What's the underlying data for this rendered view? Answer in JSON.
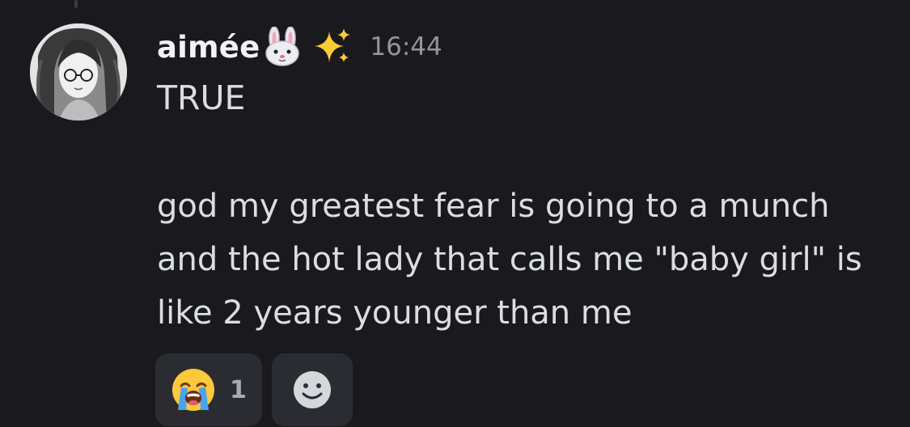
{
  "message": {
    "author": "aimée",
    "author_emoji_icons": [
      "rabbit-face-icon",
      "sparkles-icon"
    ],
    "timestamp": "16:44",
    "first_line": "TRUE",
    "paragraph_lines": [
      "god my greatest fear is going to a munch",
      "and the hot lady that calls me \"baby girl\" is",
      "like 2 years younger than me"
    ]
  },
  "reactions": [
    {
      "icon": "loudly-crying-face-icon",
      "count": "1"
    },
    {
      "icon": "add-reaction-smiley-icon"
    }
  ],
  "colors": {
    "background": "#1a1a1e",
    "username": "#f2f3f5",
    "text": "#dbdee1",
    "timestamp": "#94959c",
    "reaction_bg": "#2b2c31"
  }
}
